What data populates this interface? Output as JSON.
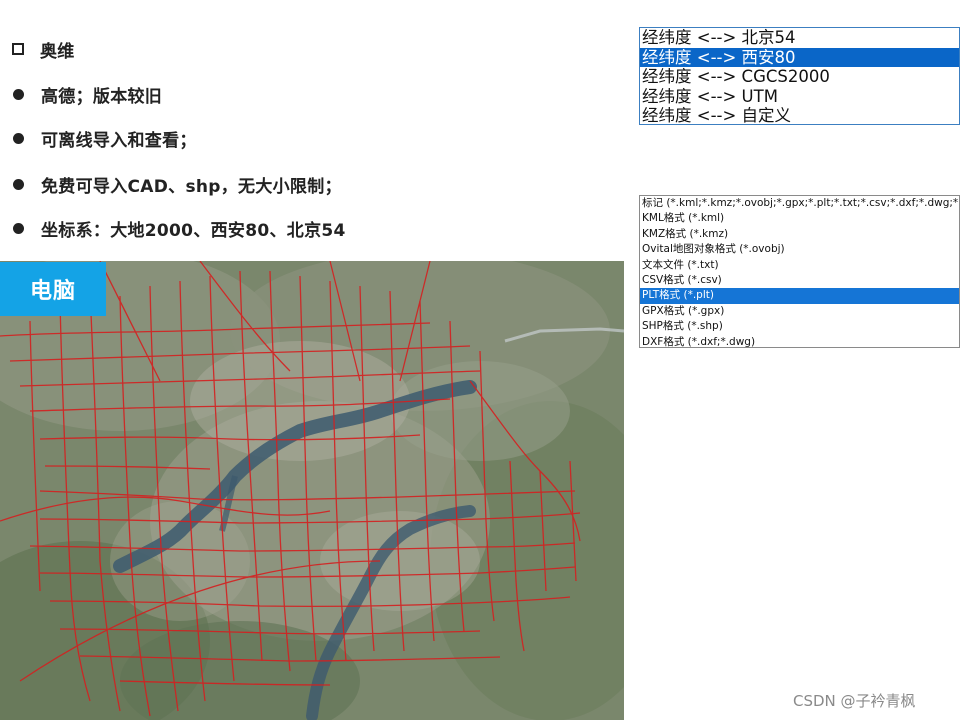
{
  "bullets": [
    {
      "marker": "square",
      "text": "奥维"
    },
    {
      "marker": "dot",
      "text": "高德；版本较旧"
    },
    {
      "marker": "dot",
      "text": "可离线导入和查看；"
    },
    {
      "marker": "dot",
      "text": "免费可导入CAD、shp，无大小限制；"
    },
    {
      "marker": "dot",
      "text": "坐标系：大地2000、西安80、北京54"
    }
  ],
  "map": {
    "label": "电脑",
    "label_color": "#14a3e6",
    "road_color": "#d42020",
    "water_color": "#3d5a6e"
  },
  "coord_list": {
    "items": [
      {
        "label": "经纬度 <--> 北京54",
        "selected": false
      },
      {
        "label": "经纬度 <--> 西安80",
        "selected": true
      },
      {
        "label": "经纬度 <--> CGCS2000",
        "selected": false
      },
      {
        "label": "经纬度 <--> UTM",
        "selected": false
      },
      {
        "label": "经纬度 <--> 自定义",
        "selected": false
      }
    ]
  },
  "format_list": {
    "items": [
      {
        "label": "标记 (*.kml;*.kmz;*.ovobj;*.gpx;*.plt;*.txt;*.csv;*.dxf;*.dwg;*.shp)",
        "selected": false
      },
      {
        "label": "KML格式 (*.kml)",
        "selected": false
      },
      {
        "label": "KMZ格式 (*.kmz)",
        "selected": false
      },
      {
        "label": "Ovital地图对象格式 (*.ovobj)",
        "selected": false
      },
      {
        "label": "文本文件 (*.txt)",
        "selected": false
      },
      {
        "label": "CSV格式 (*.csv)",
        "selected": false
      },
      {
        "label": "PLT格式 (*.plt)",
        "selected": true
      },
      {
        "label": "GPX格式 (*.gpx)",
        "selected": false
      },
      {
        "label": "SHP格式 (*.shp)",
        "selected": false
      },
      {
        "label": "DXF格式 (*.dxf;*.dwg)",
        "selected": false
      }
    ]
  },
  "watermark": "CSDN @子衿青枫"
}
